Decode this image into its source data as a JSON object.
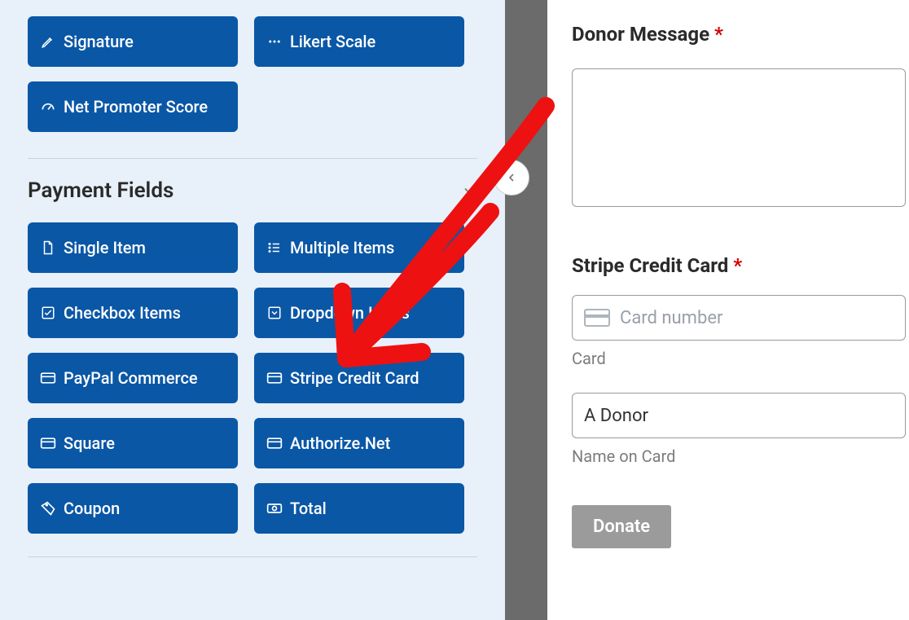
{
  "sidebar": {
    "row1": [
      "Signature",
      "Likert Scale"
    ],
    "row2": [
      "Net Promoter Score"
    ],
    "payment_section_title": "Payment Fields",
    "payment_rows": [
      [
        "Single Item",
        "Multiple Items"
      ],
      [
        "Checkbox Items",
        "Dropdown Items"
      ],
      [
        "PayPal Commerce",
        "Stripe Credit Card"
      ],
      [
        "Square",
        "Authorize.Net"
      ],
      [
        "Coupon",
        "Total"
      ]
    ]
  },
  "form": {
    "donor_message_label": "Donor Message",
    "stripe_label": "Stripe Credit Card",
    "card_placeholder": "Card number",
    "card_sublabel": "Card",
    "name_value": "A Donor",
    "name_sublabel": "Name on Card",
    "submit_label": "Donate",
    "required_mark": "*"
  }
}
